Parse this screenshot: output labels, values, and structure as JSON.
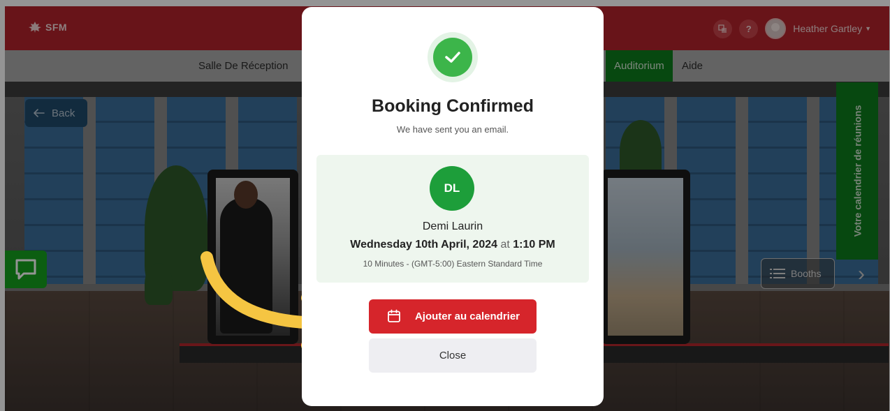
{
  "app": {
    "logo_text": "SFM",
    "user_name": "Heather Gartley",
    "help_label": "?"
  },
  "nav": {
    "items": [
      {
        "label": "Salle De Réception"
      },
      {
        "label": "Auditorium",
        "active": true
      },
      {
        "label": "Aide"
      }
    ]
  },
  "scene": {
    "back_label": "Back",
    "vertical_tab_label": "Votre calendrier de réunions",
    "booths_label": "Booths"
  },
  "modal": {
    "title": "Booking Confirmed",
    "subtitle": "We have sent you an email.",
    "host_initials": "DL",
    "host_name": "Demi Laurin",
    "date_text": "Wednesday 10th April, 2024",
    "at_text": "at",
    "time_text": "1:10 PM",
    "duration_text": "10 Minutes - (GMT-5:00) Eastern Standard Time",
    "add_calendar_label": "Ajouter au calendrier",
    "close_label": "Close"
  },
  "colors": {
    "brand_red": "#b3232b",
    "active_green": "#0d7d1c",
    "success_green": "#3cb54a",
    "avatar_green": "#1d9e3a",
    "calendar_button_red": "#d6252b",
    "arrow_yellow": "#f5c542"
  }
}
